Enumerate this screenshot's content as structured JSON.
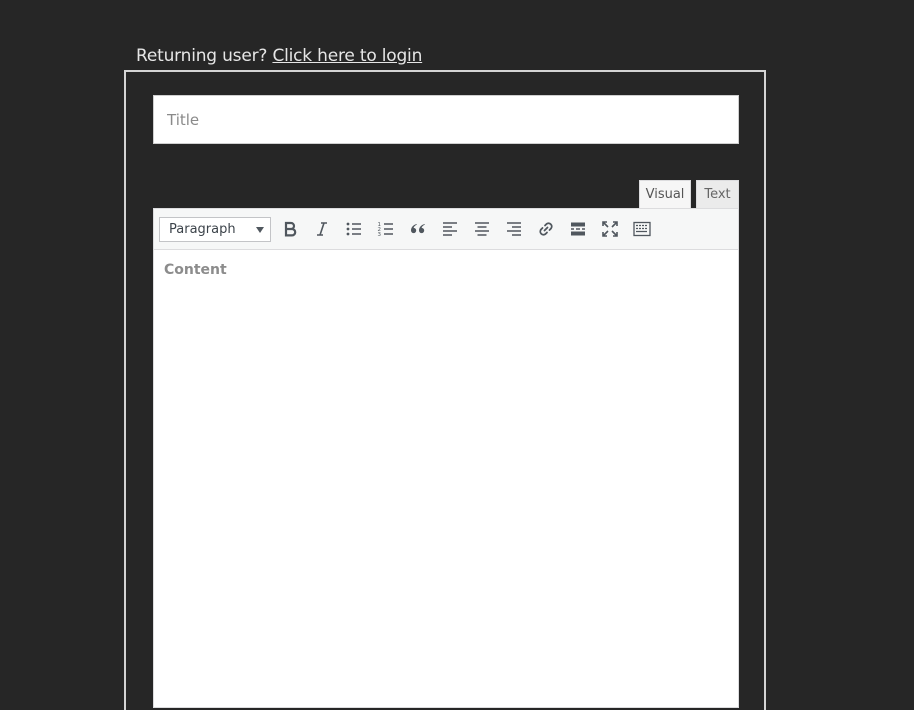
{
  "login_prompt": {
    "text": "Returning user?",
    "link_label": "Click here to login"
  },
  "title_field": {
    "placeholder": "Title",
    "value": ""
  },
  "editor": {
    "tabs": [
      {
        "label": "Visual",
        "active": true
      },
      {
        "label": "Text",
        "active": false
      }
    ],
    "format_select": {
      "selected": "Paragraph"
    },
    "toolbar_icons": [
      "bold-icon",
      "italic-icon",
      "bulleted-list-icon",
      "numbered-list-icon",
      "blockquote-icon",
      "align-left-icon",
      "align-center-icon",
      "align-right-icon",
      "link-icon",
      "read-more-icon",
      "fullscreen-icon",
      "toolbar-toggle-icon"
    ],
    "content_placeholder": "Content"
  },
  "colors": {
    "page_background": "#262626",
    "editor_background": "#ffffff",
    "toolbar_background": "#f6f7f7",
    "icon_color": "#50575e"
  }
}
